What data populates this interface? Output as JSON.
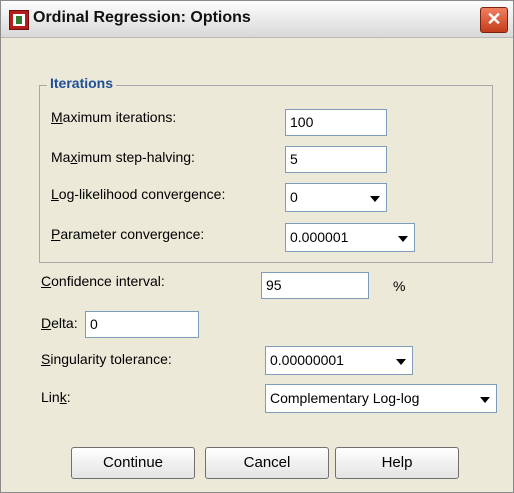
{
  "window": {
    "title": "Ordinal Regression: Options",
    "close_glyph": "✕"
  },
  "iterations": {
    "group_title": "Iterations",
    "max_iterations_label": {
      "pre": "",
      "u": "M",
      "post": "aximum iterations:"
    },
    "max_iterations_value": "100",
    "max_step_halving_label": {
      "pre": "Ma",
      "u": "x",
      "post": "imum step-halving:"
    },
    "max_step_halving_value": "5",
    "loglik_label": {
      "pre": "",
      "u": "L",
      "post": "og-likelihood convergence:"
    },
    "loglik_value": "0",
    "param_label": {
      "pre": "",
      "u": "P",
      "post": "arameter convergence:"
    },
    "param_value": "0.000001"
  },
  "options": {
    "confidence_label": {
      "pre": "",
      "u": "C",
      "post": "onfidence interval:"
    },
    "confidence_value": "95",
    "confidence_unit": "%",
    "delta_label": {
      "pre": "",
      "u": "D",
      "post": "elta:"
    },
    "delta_value": "0",
    "singularity_label": {
      "pre": "",
      "u": "S",
      "post": "ingularity tolerance:"
    },
    "singularity_value": "0.00000001",
    "link_label": {
      "pre": "Lin",
      "u": "k",
      "post": ":"
    },
    "link_value": "Complementary Log-log"
  },
  "buttons": {
    "continue": "Continue",
    "cancel": "Cancel",
    "help": "Help"
  }
}
